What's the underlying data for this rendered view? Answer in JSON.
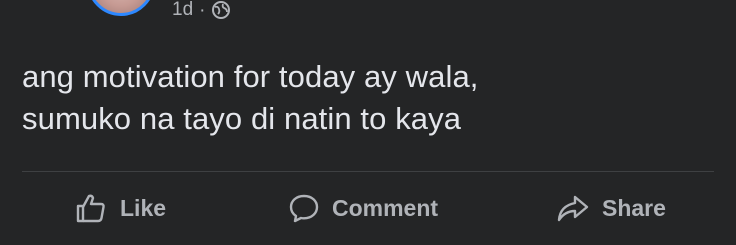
{
  "post": {
    "timestamp": "1d",
    "separator": "·",
    "privacy_icon": "globe-icon",
    "text": "ang motivation for today ay wala,\nsumuko na tayo di natin to kaya"
  },
  "actions": {
    "like_label": "Like",
    "comment_label": "Comment",
    "share_label": "Share"
  },
  "colors": {
    "background": "#242526",
    "primary_text": "#e4e6eb",
    "secondary_text": "#b0b3b8",
    "avatar_ring": "#2d88ff",
    "divider": "#3e4042"
  }
}
